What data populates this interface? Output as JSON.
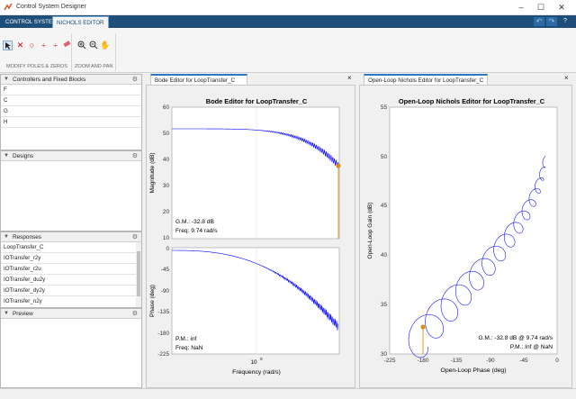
{
  "window": {
    "title": "Control System Designer"
  },
  "tabs": [
    {
      "label": "CONTROL SYSTEM"
    },
    {
      "label": "NICHOLS EDITOR"
    }
  ],
  "toolstrip": {
    "groups": [
      {
        "label": "MODIFY POLES & ZEROS"
      },
      {
        "label": "ZOOM AND PAN"
      }
    ]
  },
  "left": {
    "controllers": {
      "title": "Controllers and Fixed Blocks",
      "items": [
        "F",
        "C",
        "G",
        "H"
      ]
    },
    "designs": {
      "title": "Designs"
    },
    "responses": {
      "title": "Responses",
      "items": [
        "LoopTransfer_C",
        "IOTransfer_r2y",
        "IOTransfer_r2u",
        "IOTransfer_du2y",
        "IOTransfer_dy2y",
        "IOTransfer_n2y"
      ]
    },
    "preview": {
      "title": "Preview"
    }
  },
  "bode": {
    "tab_label": "Bode Editor for LoopTransfer_C",
    "title": "Bode Editor for LoopTransfer_C",
    "mag_ylabel": "Magnitude (dB)",
    "mag_ticks": [
      "60",
      "50",
      "40",
      "30",
      "20",
      "10"
    ],
    "phase_ylabel": "Phase (deg)",
    "phase_ticks": [
      "0",
      "-45",
      "-90",
      "-135",
      "-180",
      "-225"
    ],
    "xlabel": "Frequency (rad/s)",
    "xtick": "10",
    "xtick_exp": "0",
    "gm_text": "G.M.: -32.8 dB",
    "gm_freq": "Freq: 9.74 rad/s",
    "pm_text": "P.M.: inf",
    "pm_freq": "Freq: NaN"
  },
  "nichols": {
    "tab_label": "Open-Loop Nichols Editor for LoopTransfer_C",
    "title": "Open-Loop Nichols Editor for LoopTransfer_C",
    "ylabel": "Open-Loop Gain (dB)",
    "xlabel": "Open-Loop Phase (deg)",
    "yticks": [
      "55",
      "50",
      "45",
      "40",
      "35",
      "30"
    ],
    "xticks": [
      "-225",
      "-180",
      "-135",
      "-90",
      "-45",
      "0"
    ],
    "gm_text": "G.M.: -32.8 dB @ 9.74 rad/s",
    "pm_text": "P.M.: Inf @ NaN"
  },
  "colors": {
    "accent": "#1f4e79",
    "curve": "#0000ff",
    "marker": "#e69100"
  }
}
